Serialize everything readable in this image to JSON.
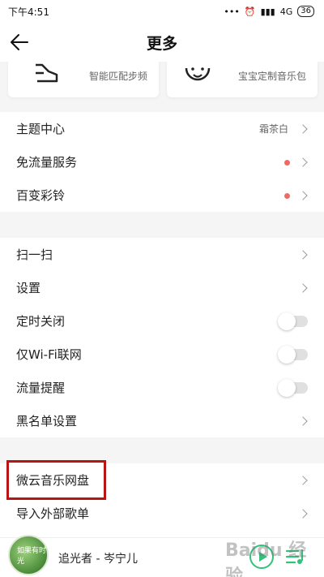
{
  "status": {
    "time": "下午4:51",
    "network": "4G",
    "battery": "36"
  },
  "header": {
    "title": "更多"
  },
  "cards": [
    {
      "label": "智能匹配步频",
      "icon": "running-shoe-icon"
    },
    {
      "label": "宝宝定制音乐包",
      "icon": "baby-face-icon"
    }
  ],
  "section1": [
    {
      "label": "主题中心",
      "value": "霜茶白"
    },
    {
      "label": "免流量服务"
    },
    {
      "label": "百变彩铃"
    }
  ],
  "section2": [
    {
      "label": "扫一扫"
    },
    {
      "label": "设置"
    },
    {
      "label": "定时关闭"
    },
    {
      "label": "仅Wi-Fi联网"
    },
    {
      "label": "流量提醒"
    },
    {
      "label": "黑名单设置"
    }
  ],
  "section3": [
    {
      "label": "微云音乐网盘"
    },
    {
      "label": "导入外部歌单"
    }
  ],
  "player": {
    "song": "追光者 - 岑宁儿",
    "cover_text": "如果有时光"
  },
  "watermark": "Baidu 经验",
  "colors": {
    "accent": "#31c27c",
    "red_dot": "#f06a64",
    "highlight": "#b81414"
  }
}
